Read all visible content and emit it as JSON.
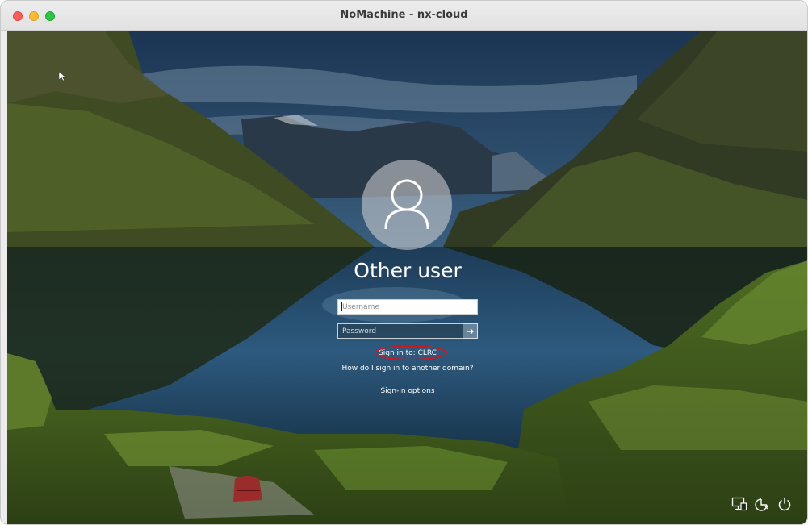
{
  "window": {
    "title": "NoMachine - nx-cloud"
  },
  "login": {
    "display_name": "Other user",
    "username_placeholder": "Username",
    "password_placeholder": "Password",
    "submit_icon": "arrow-right-icon",
    "domain_text": "Sign in to: CLRC",
    "other_domain_link": "How do I sign in to another domain?",
    "signin_options_link": "Sign-in options",
    "highlight_color": "#d3161c"
  },
  "tray": {
    "icons": [
      "network-icon",
      "accessibility-icon",
      "power-icon"
    ]
  }
}
